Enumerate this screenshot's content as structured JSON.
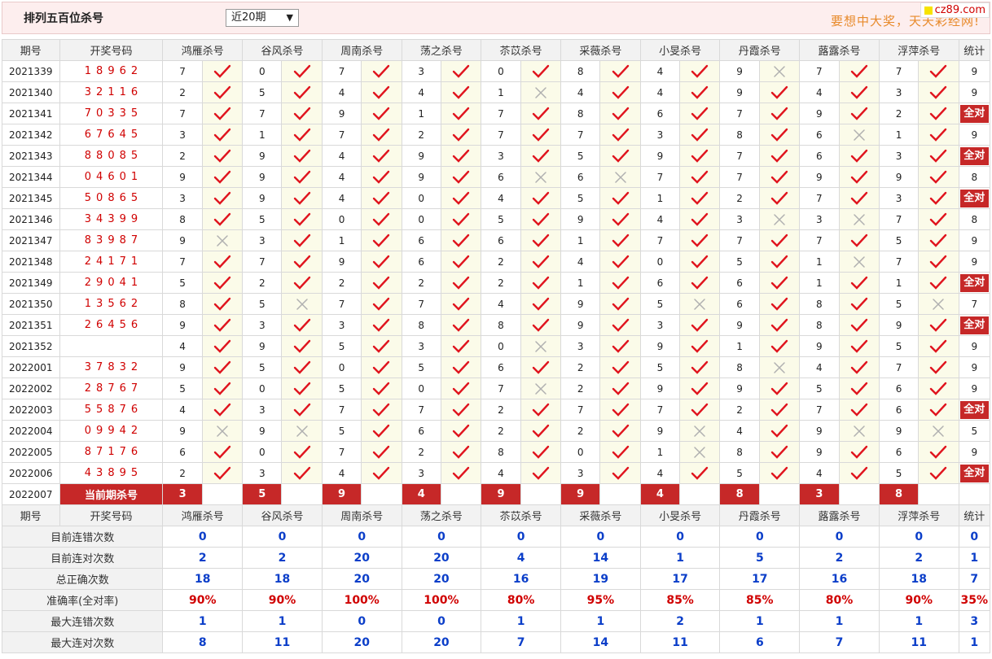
{
  "header": {
    "title": "排列五百位杀号",
    "select_value": "近20期",
    "slogan": "要想中大奖，天天彩经网!",
    "site_badge": "cz89.com"
  },
  "columns": {
    "issue": "期号",
    "numbers": "开奖号码",
    "experts": [
      "鸿雁杀号",
      "谷风杀号",
      "周南杀号",
      "荡之杀号",
      "苶苡杀号",
      "采薇杀号",
      "小旻杀号",
      "丹霞杀号",
      "蕗露杀号",
      "浮萍杀号"
    ],
    "total": "统计"
  },
  "rows": [
    {
      "issue": "2021339",
      "numbers": "18962",
      "kills": [
        "7",
        "0",
        "7",
        "3",
        "0",
        "8",
        "4",
        "9",
        "7",
        "7"
      ],
      "marks": [
        1,
        1,
        1,
        1,
        1,
        1,
        1,
        0,
        1,
        1
      ],
      "total": "9"
    },
    {
      "issue": "2021340",
      "numbers": "32116",
      "kills": [
        "2",
        "5",
        "4",
        "4",
        "1",
        "4",
        "4",
        "9",
        "4",
        "3"
      ],
      "marks": [
        1,
        1,
        1,
        1,
        0,
        1,
        1,
        1,
        1,
        1
      ],
      "total": "9"
    },
    {
      "issue": "2021341",
      "numbers": "70335",
      "kills": [
        "7",
        "7",
        "9",
        "1",
        "7",
        "8",
        "6",
        "7",
        "9",
        "2"
      ],
      "marks": [
        1,
        1,
        1,
        1,
        1,
        1,
        1,
        1,
        1,
        1
      ],
      "total": "全对"
    },
    {
      "issue": "2021342",
      "numbers": "67645",
      "kills": [
        "3",
        "1",
        "7",
        "2",
        "7",
        "7",
        "3",
        "8",
        "6",
        "1"
      ],
      "marks": [
        1,
        1,
        1,
        1,
        1,
        1,
        1,
        1,
        0,
        1
      ],
      "total": "9"
    },
    {
      "issue": "2021343",
      "numbers": "88085",
      "kills": [
        "2",
        "9",
        "4",
        "9",
        "3",
        "5",
        "9",
        "7",
        "6",
        "3"
      ],
      "marks": [
        1,
        1,
        1,
        1,
        1,
        1,
        1,
        1,
        1,
        1
      ],
      "total": "全对"
    },
    {
      "issue": "2021344",
      "numbers": "04601",
      "kills": [
        "9",
        "9",
        "4",
        "9",
        "6",
        "6",
        "7",
        "7",
        "9",
        "9"
      ],
      "marks": [
        1,
        1,
        1,
        1,
        0,
        0,
        1,
        1,
        1,
        1
      ],
      "total": "8"
    },
    {
      "issue": "2021345",
      "numbers": "50865",
      "kills": [
        "3",
        "9",
        "4",
        "0",
        "4",
        "5",
        "1",
        "2",
        "7",
        "3"
      ],
      "marks": [
        1,
        1,
        1,
        1,
        1,
        1,
        1,
        1,
        1,
        1
      ],
      "total": "全对"
    },
    {
      "issue": "2021346",
      "numbers": "34399",
      "kills": [
        "8",
        "5",
        "0",
        "0",
        "5",
        "9",
        "4",
        "3",
        "3",
        "7"
      ],
      "marks": [
        1,
        1,
        1,
        1,
        1,
        1,
        1,
        0,
        0,
        1
      ],
      "total": "8"
    },
    {
      "issue": "2021347",
      "numbers": "83987",
      "kills": [
        "9",
        "3",
        "1",
        "6",
        "6",
        "1",
        "7",
        "7",
        "7",
        "5"
      ],
      "marks": [
        0,
        1,
        1,
        1,
        1,
        1,
        1,
        1,
        1,
        1
      ],
      "total": "9"
    },
    {
      "issue": "2021348",
      "numbers": "24171",
      "kills": [
        "7",
        "7",
        "9",
        "6",
        "2",
        "4",
        "0",
        "5",
        "1",
        "7"
      ],
      "marks": [
        1,
        1,
        1,
        1,
        1,
        1,
        1,
        1,
        0,
        1
      ],
      "total": "9"
    },
    {
      "issue": "2021349",
      "numbers": "29041",
      "kills": [
        "5",
        "2",
        "2",
        "2",
        "2",
        "1",
        "6",
        "6",
        "1",
        "1"
      ],
      "marks": [
        1,
        1,
        1,
        1,
        1,
        1,
        1,
        1,
        1,
        1
      ],
      "total": "全对"
    },
    {
      "issue": "2021350",
      "numbers": "13562",
      "kills": [
        "8",
        "5",
        "7",
        "7",
        "4",
        "9",
        "5",
        "6",
        "8",
        "5"
      ],
      "marks": [
        1,
        0,
        1,
        1,
        1,
        1,
        0,
        1,
        1,
        0
      ],
      "total": "7"
    },
    {
      "issue": "2021351",
      "numbers": "26456",
      "kills": [
        "9",
        "3",
        "3",
        "8",
        "8",
        "9",
        "3",
        "9",
        "8",
        "9"
      ],
      "marks": [
        1,
        1,
        1,
        1,
        1,
        1,
        1,
        1,
        1,
        1
      ],
      "total": "全对"
    },
    {
      "issue": "2021352",
      "numbers": "",
      "kills": [
        "4",
        "9",
        "5",
        "3",
        "0",
        "3",
        "9",
        "1",
        "9",
        "5"
      ],
      "marks": [
        1,
        1,
        1,
        1,
        0,
        1,
        1,
        1,
        1,
        1
      ],
      "total": "9"
    },
    {
      "issue": "2022001",
      "numbers": "37832",
      "kills": [
        "9",
        "5",
        "0",
        "5",
        "6",
        "2",
        "5",
        "8",
        "4",
        "7"
      ],
      "marks": [
        1,
        1,
        1,
        1,
        1,
        1,
        1,
        0,
        1,
        1
      ],
      "total": "9"
    },
    {
      "issue": "2022002",
      "numbers": "28767",
      "kills": [
        "5",
        "0",
        "5",
        "0",
        "7",
        "2",
        "9",
        "9",
        "5",
        "6"
      ],
      "marks": [
        1,
        1,
        1,
        1,
        0,
        1,
        1,
        1,
        1,
        1
      ],
      "total": "9"
    },
    {
      "issue": "2022003",
      "numbers": "55876",
      "kills": [
        "4",
        "3",
        "7",
        "7",
        "2",
        "7",
        "7",
        "2",
        "7",
        "6"
      ],
      "marks": [
        1,
        1,
        1,
        1,
        1,
        1,
        1,
        1,
        1,
        1
      ],
      "total": "全对"
    },
    {
      "issue": "2022004",
      "numbers": "09942",
      "kills": [
        "9",
        "9",
        "5",
        "6",
        "2",
        "2",
        "9",
        "4",
        "9",
        "9"
      ],
      "marks": [
        0,
        0,
        1,
        1,
        1,
        1,
        0,
        1,
        0,
        0
      ],
      "total": "5"
    },
    {
      "issue": "2022005",
      "numbers": "87176",
      "kills": [
        "6",
        "0",
        "7",
        "2",
        "8",
        "0",
        "1",
        "8",
        "9",
        "6"
      ],
      "marks": [
        1,
        1,
        1,
        1,
        1,
        1,
        0,
        1,
        1,
        1
      ],
      "total": "9"
    },
    {
      "issue": "2022006",
      "numbers": "43895",
      "kills": [
        "2",
        "3",
        "4",
        "3",
        "4",
        "3",
        "4",
        "5",
        "4",
        "5"
      ],
      "marks": [
        1,
        1,
        1,
        1,
        1,
        1,
        1,
        1,
        1,
        1
      ],
      "total": "全对"
    }
  ],
  "current": {
    "issue": "2022007",
    "label": "当前期杀号",
    "kills": [
      "3",
      "5",
      "9",
      "4",
      "9",
      "9",
      "4",
      "8",
      "3",
      "8"
    ]
  },
  "stats": [
    {
      "label": "目前连错次数",
      "values": [
        "0",
        "0",
        "0",
        "0",
        "0",
        "0",
        "0",
        "0",
        "0",
        "0"
      ],
      "total": "0",
      "color": "blue"
    },
    {
      "label": "目前连对次数",
      "values": [
        "2",
        "2",
        "20",
        "20",
        "4",
        "14",
        "1",
        "5",
        "2",
        "2"
      ],
      "total": "1",
      "color": "blue"
    },
    {
      "label": "总正确次数",
      "values": [
        "18",
        "18",
        "20",
        "20",
        "16",
        "19",
        "17",
        "17",
        "16",
        "18"
      ],
      "total": "7",
      "color": "blue"
    },
    {
      "label": "准确率(全对率)",
      "values": [
        "90%",
        "90%",
        "100%",
        "100%",
        "80%",
        "95%",
        "85%",
        "85%",
        "80%",
        "90%"
      ],
      "total": "35%",
      "color": "red"
    },
    {
      "label": "最大连错次数",
      "values": [
        "1",
        "1",
        "0",
        "0",
        "1",
        "1",
        "2",
        "1",
        "1",
        "1"
      ],
      "total": "3",
      "color": "blue"
    },
    {
      "label": "最大连对次数",
      "values": [
        "8",
        "11",
        "20",
        "20",
        "7",
        "14",
        "11",
        "6",
        "7",
        "11"
      ],
      "total": "1",
      "color": "blue"
    }
  ],
  "colors": {
    "accent_red": "#c62828",
    "number_red": "#d00000",
    "stat_blue": "#0b3ec9",
    "slogan": "#e88a2b"
  },
  "icons": {
    "correct": "check-icon",
    "wrong": "cross-icon"
  }
}
